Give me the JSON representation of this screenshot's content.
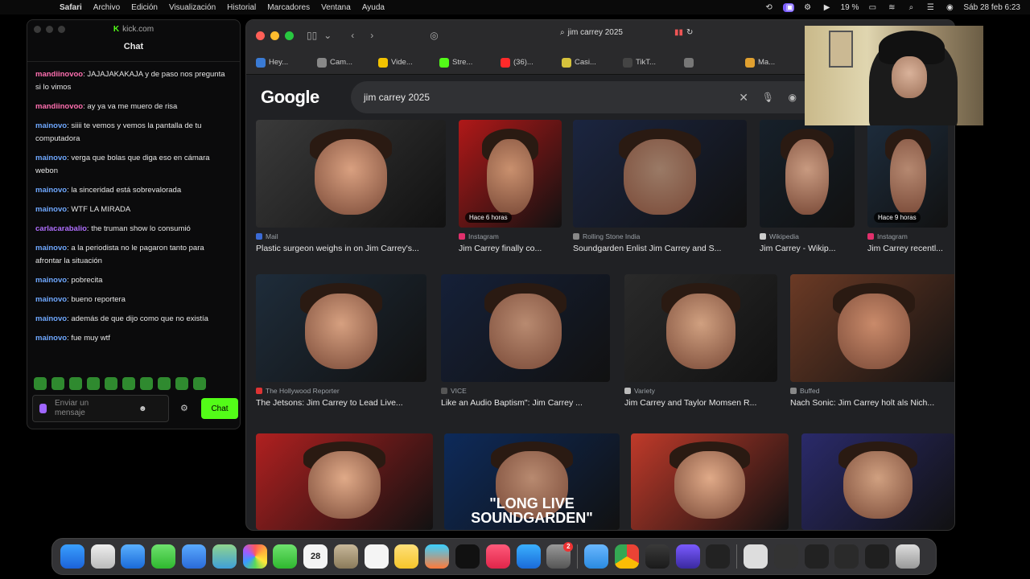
{
  "menubar": {
    "items": [
      "Safari",
      "Archivo",
      "Edición",
      "Visualización",
      "Historial",
      "Marcadores",
      "Ventana",
      "Ayuda"
    ],
    "battery": "19 %",
    "datetime": "Sáb 28 feb 6:23"
  },
  "chat": {
    "window_title": "kick.com",
    "header": "Chat",
    "messages": [
      {
        "user": "mandiinovoo",
        "text": "JAJAJAKAKAJA y de paso nos pregunta si lo vimos",
        "color": "#ff6fb0"
      },
      {
        "user": "mandiinovoo",
        "text": "ay ya va me muero de risa",
        "color": "#ff6fb0"
      },
      {
        "user": "mainovo",
        "text": "siiii te vemos y vemos la pantalla de tu computadora",
        "color": "#6fa8ff"
      },
      {
        "user": "mainovo",
        "text": "verga que bolas que diga eso en cámara webon",
        "color": "#6fa8ff"
      },
      {
        "user": "mainovo",
        "text": "la sinceridad está sobrevalorada",
        "color": "#6fa8ff"
      },
      {
        "user": "mainovo",
        "text": "WTF LA MIRADA",
        "color": "#6fa8ff"
      },
      {
        "user": "carlacarabalio",
        "text": "the truman show lo consumió",
        "color": "#b06fff"
      },
      {
        "user": "mainovo",
        "text": "a la periodista no le pagaron tanto para afrontar la situación",
        "color": "#6fa8ff"
      },
      {
        "user": "mainovo",
        "text": "pobrecita",
        "color": "#6fa8ff"
      },
      {
        "user": "mainovo",
        "text": "bueno reportera",
        "color": "#6fa8ff"
      },
      {
        "user": "mainovo",
        "text": "además de que dijo como que no existía",
        "color": "#6fa8ff"
      },
      {
        "user": "mainovo",
        "text": "fue muy wtf",
        "color": "#6fa8ff"
      }
    ],
    "input_placeholder": "Enviar un mensaje",
    "send_label": "Chat"
  },
  "safari": {
    "address": "jim carrey 2025",
    "favorites": [
      {
        "label": "Hey...",
        "color": "#3a7bd5"
      },
      {
        "label": "Cam...",
        "color": "#888"
      },
      {
        "label": "Vide...",
        "color": "#f2c200"
      },
      {
        "label": "Stre...",
        "color": "#53fc18"
      },
      {
        "label": "(36)...",
        "color": "#ff2a2a"
      },
      {
        "label": "Casi...",
        "color": "#d6c23c"
      },
      {
        "label": "TikT...",
        "color": "#444"
      },
      {
        "label": "",
        "color": "#777"
      },
      {
        "label": "Ma...",
        "color": "#e0a030"
      }
    ]
  },
  "google": {
    "logo": "Google",
    "query": "jim carrey 2025",
    "results": [
      {
        "source": "Mail",
        "title": "Plastic surgeon weighs in on Jim Carrey's...",
        "badge": "",
        "overlay": "",
        "scolor": "#3b6bd6"
      },
      {
        "source": "Instagram",
        "title": "Jim Carrey finally co...",
        "badge": "Hace 6 horas",
        "overlay": "",
        "scolor": "#e1306c"
      },
      {
        "source": "Rolling Stone India",
        "title": "Soundgarden Enlist Jim Carrey and S...",
        "badge": "",
        "overlay": "",
        "scolor": "#888"
      },
      {
        "source": "Wikipedia",
        "title": "Jim Carrey - Wikip...",
        "badge": "",
        "overlay": "",
        "scolor": "#ccc"
      },
      {
        "source": "Instagram",
        "title": "Jim Carrey recentl...",
        "badge": "Hace 9 horas",
        "overlay": "",
        "scolor": "#e1306c"
      },
      {
        "source": "The Hollywood Reporter",
        "title": "The Jetsons: Jim Carrey to Lead Live...",
        "badge": "",
        "overlay": "",
        "scolor": "#d33"
      },
      {
        "source": "VICE",
        "title": "Like an Audio Baptism\": Jim Carrey ...",
        "badge": "",
        "overlay": "",
        "scolor": "#555"
      },
      {
        "source": "Variety",
        "title": "Jim Carrey and Taylor Momsen R...",
        "badge": "",
        "overlay": "",
        "scolor": "#bbb"
      },
      {
        "source": "Buffed",
        "title": "Nach Sonic: Jim Carrey holt als Nich...",
        "badge": "",
        "overlay": "",
        "scolor": "#888"
      },
      {
        "source": "",
        "title": "",
        "badge": "",
        "overlay": "",
        "scolor": "#888"
      },
      {
        "source": "",
        "title": "",
        "badge": "",
        "overlay": "\"LONG LIVE SOUNDGARDEN\"",
        "scolor": "#888"
      },
      {
        "source": "",
        "title": "",
        "badge": "",
        "overlay": "",
        "scolor": "#888"
      },
      {
        "source": "",
        "title": "",
        "badge": "",
        "overlay": "",
        "scolor": "#888"
      }
    ]
  },
  "dock": {
    "calendar_day": "28",
    "badge_count": "2"
  }
}
